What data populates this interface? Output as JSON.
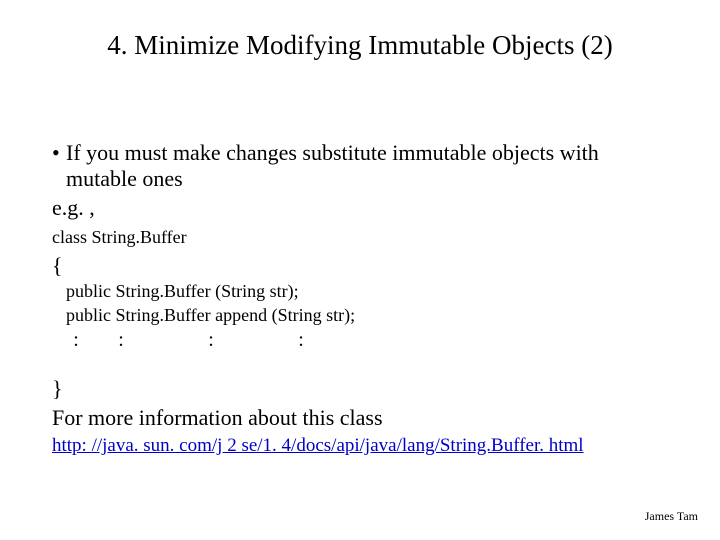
{
  "title": "4. Minimize Modifying Immutable Objects (2)",
  "bullet": {
    "text": "If you must make changes substitute immutable objects with mutable ones",
    "eg": "e.g. ,"
  },
  "code": {
    "decl": "class String.Buffer",
    "open": "{",
    "l1": "public String.Buffer (String str);",
    "l2": "public String.Buffer append (String str);",
    "colon_a": ":",
    "colon_b": ":",
    "colon_c": ":",
    "colon_d": ":",
    "close": "}"
  },
  "more_info": "For more information about this class",
  "link": "http: //java. sun. com/j 2 se/1. 4/docs/api/java/lang/String.Buffer. html",
  "author": "James Tam"
}
